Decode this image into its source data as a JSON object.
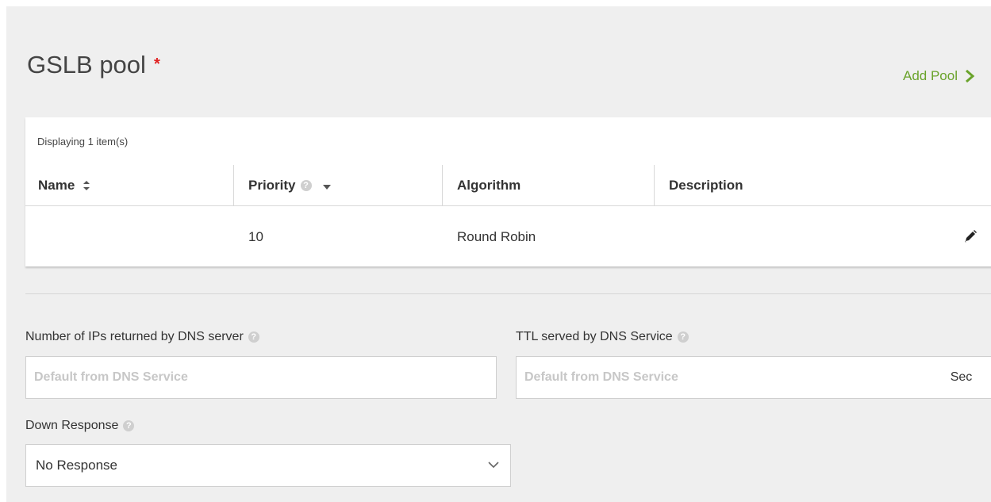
{
  "header": {
    "title": "GSLB pool",
    "required_marker": "*",
    "add_pool_label": "Add Pool"
  },
  "grid": {
    "count_label": "Displaying 1 item(s)",
    "columns": {
      "name": "Name",
      "priority": "Priority",
      "algorithm": "Algorithm",
      "description": "Description"
    },
    "rows": [
      {
        "name": "",
        "priority": "10",
        "algorithm": "Round Robin",
        "description": ""
      }
    ]
  },
  "form": {
    "num_ips": {
      "label": "Number of IPs returned by DNS server",
      "placeholder": "Default from DNS Service",
      "value": ""
    },
    "ttl": {
      "label": "TTL served by DNS Service",
      "placeholder": "Default from DNS Service",
      "value": "",
      "unit": "Sec"
    },
    "down_response": {
      "label": "Down Response",
      "selected": "No Response"
    }
  },
  "colors": {
    "accent": "#6aa32b",
    "required": "#e02020",
    "panel_bg": "#efefef"
  },
  "icons": {
    "help": "?"
  }
}
